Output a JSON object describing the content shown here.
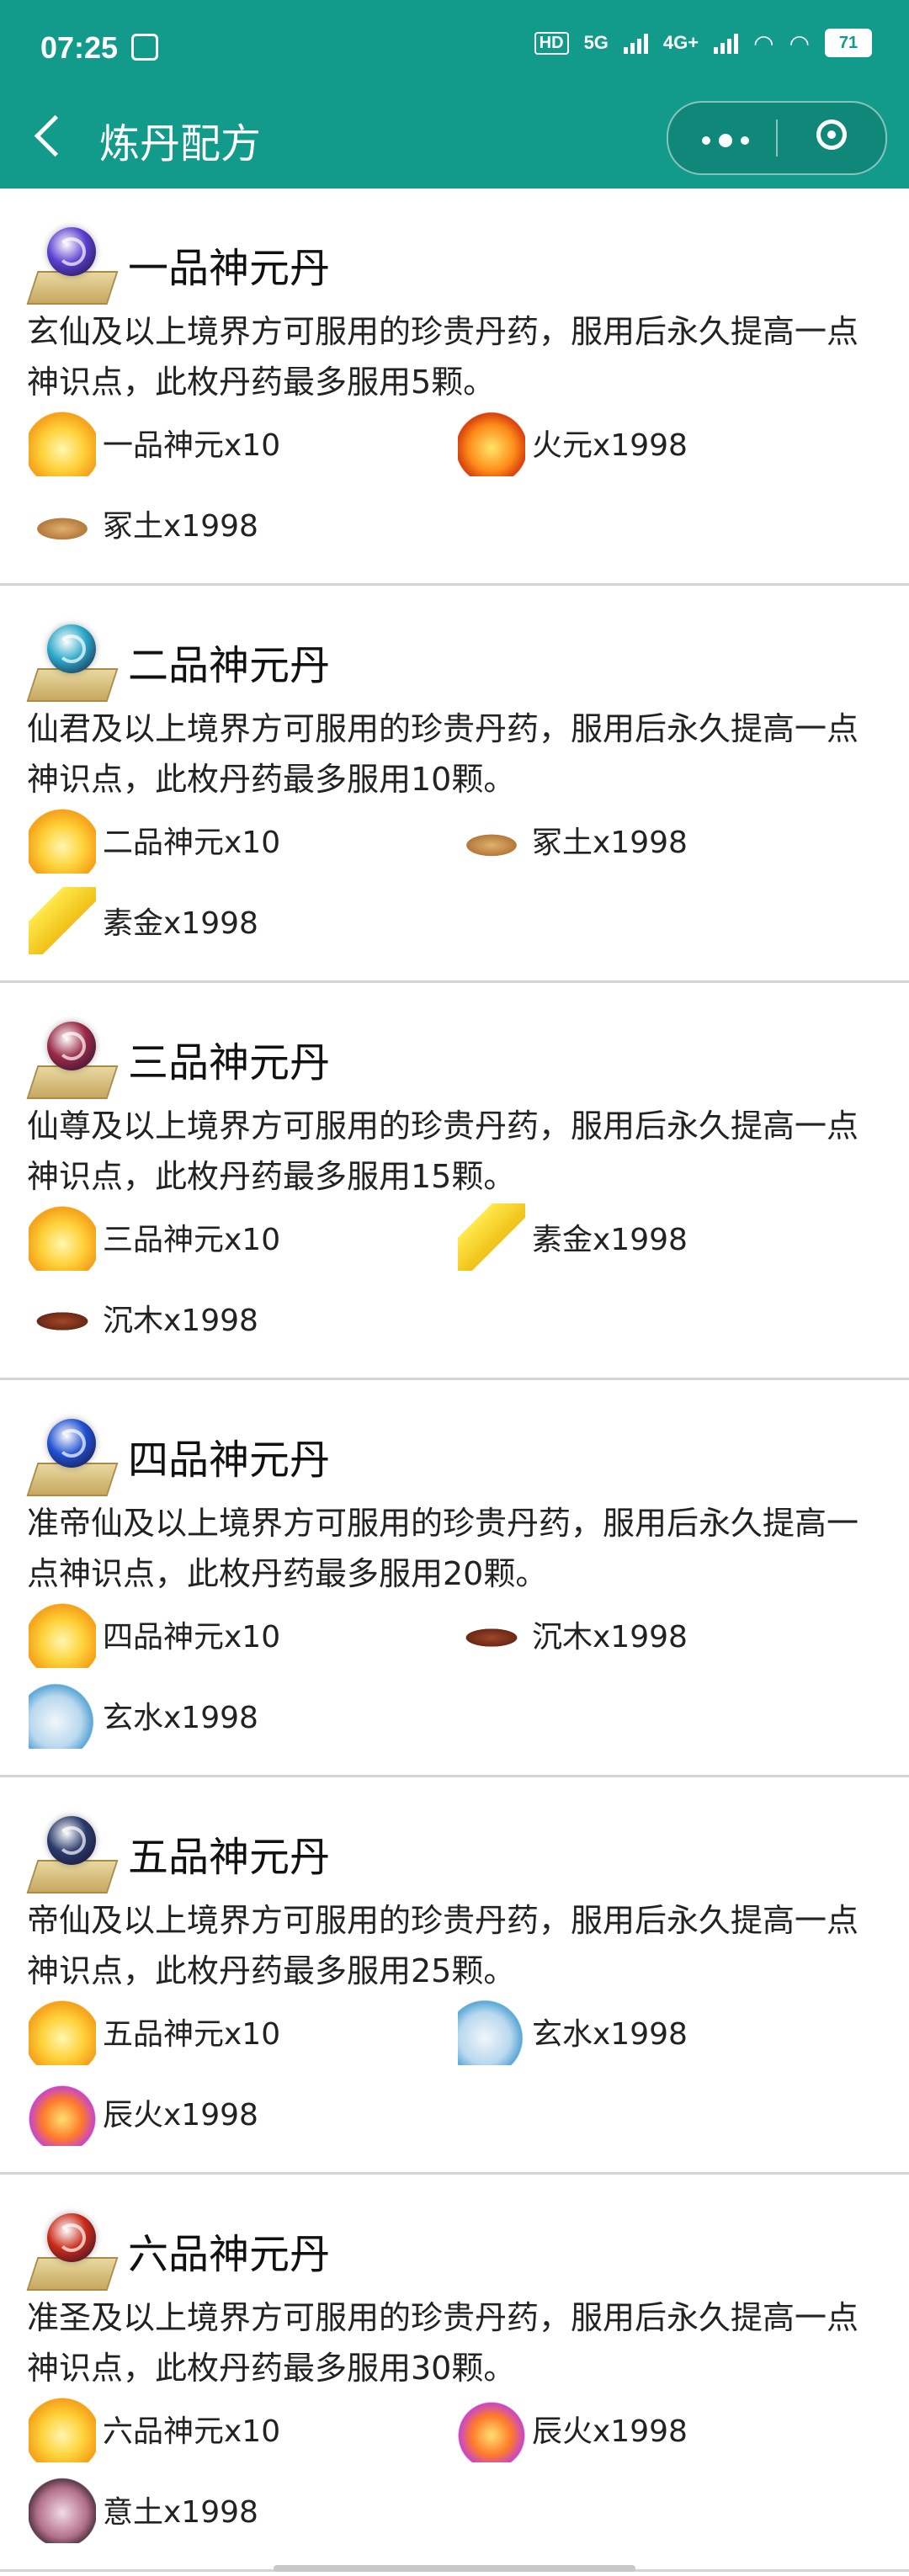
{
  "status_bar": {
    "time": "07:25",
    "hd": "HD",
    "net1": "5G",
    "net2": "4G+",
    "battery": "71"
  },
  "nav": {
    "title": "炼丹配方"
  },
  "colors": {
    "header": "#129a8a"
  },
  "recipes": [
    {
      "name": "一品神元丹",
      "orb_color": "#5a3fd0",
      "desc": "玄仙及以上境界方可服用的珍贵丹药，服用后永久提高一点神识点，此枚丹药最多服用5颗。",
      "ingredients": [
        {
          "label": "一品神元x10",
          "icon": "flame-yellow-icon"
        },
        {
          "label": "火元x1998",
          "icon": "fire-orb-icon"
        },
        {
          "label": "冢土x1998",
          "icon": "soil-icon"
        }
      ]
    },
    {
      "name": "二品神元丹",
      "orb_color": "#2aa7c8",
      "desc": "仙君及以上境界方可服用的珍贵丹药，服用后永久提高一点神识点，此枚丹药最多服用10颗。",
      "ingredients": [
        {
          "label": "二品神元x10",
          "icon": "flame-yellow-icon"
        },
        {
          "label": "冢土x1998",
          "icon": "soil-icon"
        },
        {
          "label": "素金x1998",
          "icon": "gold-icon"
        }
      ]
    },
    {
      "name": "三品神元丹",
      "orb_color": "#9a2a46",
      "desc": "仙尊及以上境界方可服用的珍贵丹药，服用后永久提高一点神识点，此枚丹药最多服用15颗。",
      "ingredients": [
        {
          "label": "三品神元x10",
          "icon": "flame-yellow-icon"
        },
        {
          "label": "素金x1998",
          "icon": "gold-icon"
        },
        {
          "label": "沉木x1998",
          "icon": "wood-icon"
        }
      ]
    },
    {
      "name": "四品神元丹",
      "orb_color": "#1f4fd0",
      "desc": "准帝仙及以上境界方可服用的珍贵丹药，服用后永久提高一点神识点，此枚丹药最多服用20颗。",
      "ingredients": [
        {
          "label": "四品神元x10",
          "icon": "flame-yellow-icon"
        },
        {
          "label": "沉木x1998",
          "icon": "wood-icon"
        },
        {
          "label": "玄水x1998",
          "icon": "water-icon"
        }
      ]
    },
    {
      "name": "五品神元丹",
      "orb_color": "#2a3a6a",
      "desc": "帝仙及以上境界方可服用的珍贵丹药，服用后永久提高一点神识点，此枚丹药最多服用25颗。",
      "ingredients": [
        {
          "label": "五品神元x10",
          "icon": "flame-yellow-icon"
        },
        {
          "label": "玄水x1998",
          "icon": "water-icon"
        },
        {
          "label": "辰火x1998",
          "icon": "purple-fire-icon"
        }
      ]
    },
    {
      "name": "六品神元丹",
      "orb_color": "#c82a18",
      "desc": "准圣及以上境界方可服用的珍贵丹药，服用后永久提高一点神识点，此枚丹药最多服用30颗。",
      "ingredients": [
        {
          "label": "六品神元x10",
          "icon": "flame-yellow-icon"
        },
        {
          "label": "辰火x1998",
          "icon": "purple-fire-icon"
        },
        {
          "label": "意土x1998",
          "icon": "yitu-icon"
        }
      ]
    }
  ]
}
